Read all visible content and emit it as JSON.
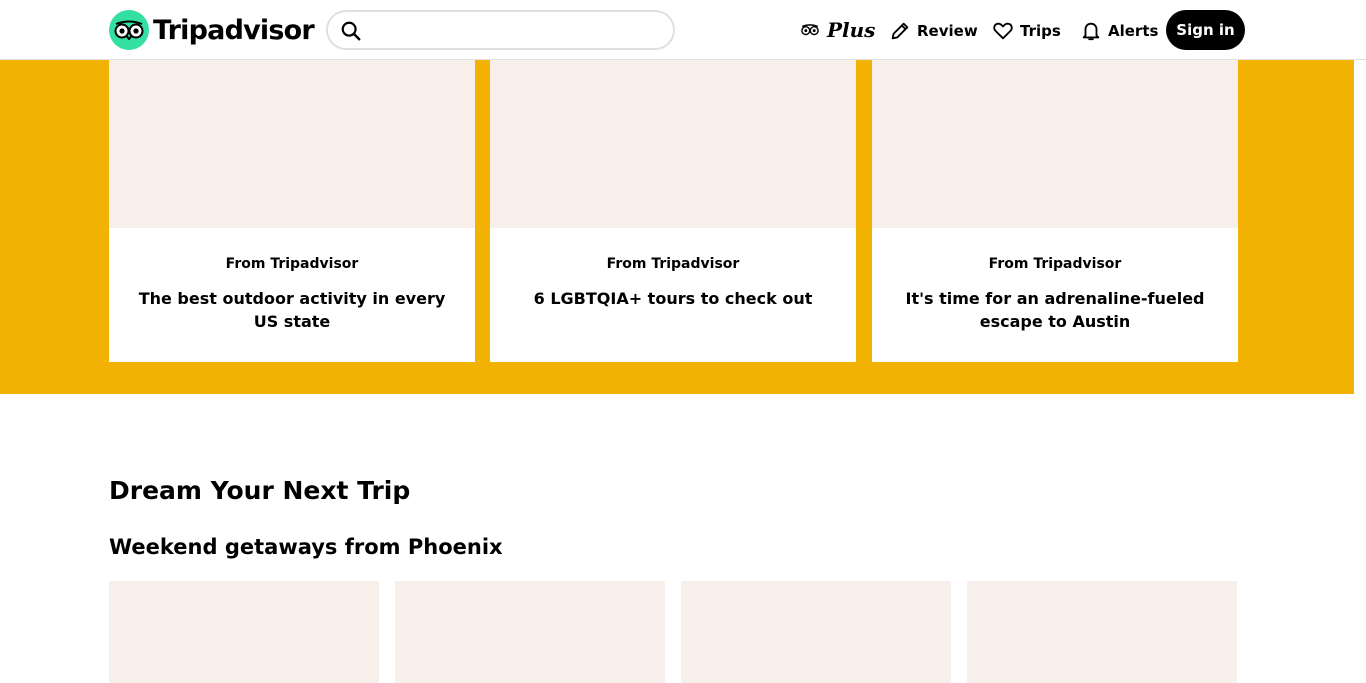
{
  "header": {
    "logo_text": "Tripadvisor",
    "search_placeholder": "",
    "nav": {
      "plus_label": "Plus",
      "review_label": "Review",
      "trips_label": "Trips",
      "alerts_label": "Alerts",
      "signin_label": "Sign in"
    }
  },
  "featured": {
    "cards": [
      {
        "source": "From Tripadvisor",
        "title": "The best outdoor activity in every US state"
      },
      {
        "source": "From Tripadvisor",
        "title": "6 LGBTQIA+ tours to check out"
      },
      {
        "source": "From Tripadvisor",
        "title": "It's time for an adrenaline-fueled escape to Austin"
      }
    ]
  },
  "dream": {
    "title": "Dream Your Next Trip",
    "subtitle": "Weekend getaways from Phoenix"
  },
  "colors": {
    "brand_green": "#34e0a1",
    "band_yellow": "#f2b203",
    "placeholder": "#f8efea"
  }
}
